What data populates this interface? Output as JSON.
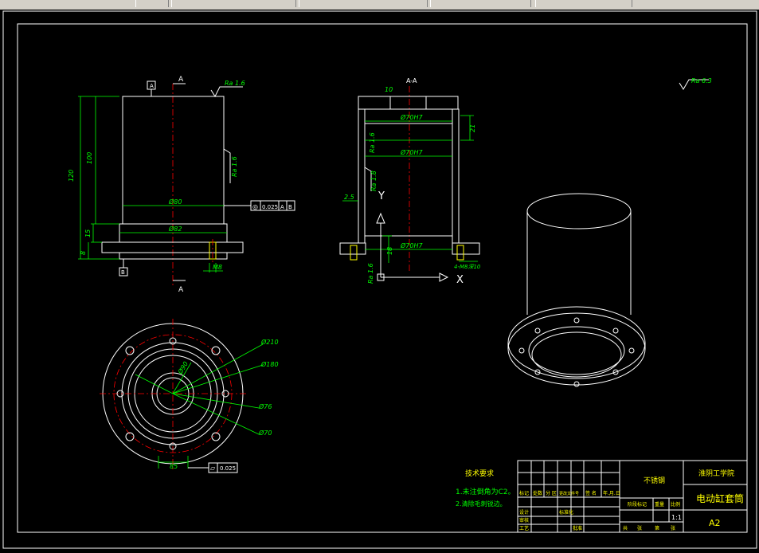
{
  "toolbar": {
    "segments": [
      "",
      "",
      "",
      "",
      ""
    ]
  },
  "drawing": {
    "front_view": {
      "datum_top": "A",
      "datum_bottom": "B",
      "section_mark_top": "A",
      "section_mark_bottom": "A",
      "roughness_top": "Ra 1.6",
      "roughness_side": "Ra 1.6",
      "dim_height_total": "120",
      "dim_height_body": "100",
      "dim_flange_1": "15",
      "dim_flange_2": "8",
      "dim_dia_body": "Ø80",
      "dim_dia_flange": "Ø82",
      "dim_hole": "M8",
      "tolerance_frame": [
        "◎",
        "0.025",
        "A",
        "B"
      ]
    },
    "section_view": {
      "title": "A-A",
      "dim_top_small": "10",
      "dim_bore_top": "Ø70H7",
      "dim_right_21": "21",
      "dim_roughness_16": "Ra 1.6",
      "dim_bore_mid": "Ø70H7",
      "dim_roughness_18": "Ra 1.8",
      "dim_left_25": "2.5",
      "dim_bore_bottom": "Ø70H7",
      "dim_bottom_18": "18",
      "dim_roughness_bottom": "Ra 1.6",
      "dim_hole_right": "4-M8深10",
      "axis_y": "Y",
      "axis_x": "X"
    },
    "general_roughness": "Ra 6.3",
    "top_view": {
      "dim_210": "Ø210",
      "dim_180": "Ø180",
      "dim_76": "Ø76",
      "dim_70": "Ø70",
      "dim_center": "Ø90",
      "dim_bottom": "85",
      "tolerance_flat": [
        "⏥",
        "0.025"
      ]
    },
    "tech_requirements": {
      "title": "技术要求",
      "item1": "1.未注倒角为C2。",
      "item2": "2.清除毛刺锐边。"
    },
    "title_block": {
      "material": "不锈钢",
      "school": "淮阴工学院",
      "part_name": "电动缸套筒",
      "scale": "1:1",
      "sheet": "A2",
      "row_labels": [
        "标记",
        "处数",
        "分 区",
        "更改文件号",
        "签 名",
        "年.月.日"
      ],
      "design": "设计",
      "standard": "标准化",
      "check": "审核",
      "process": "工艺",
      "approve": "批准",
      "stage_mark": "阶段标记",
      "weight": "重量",
      "ratio": "比例",
      "sheets_total": "共",
      "sheets_num": "张",
      "sheet_of": "第",
      "sheet_of2": "张"
    }
  }
}
